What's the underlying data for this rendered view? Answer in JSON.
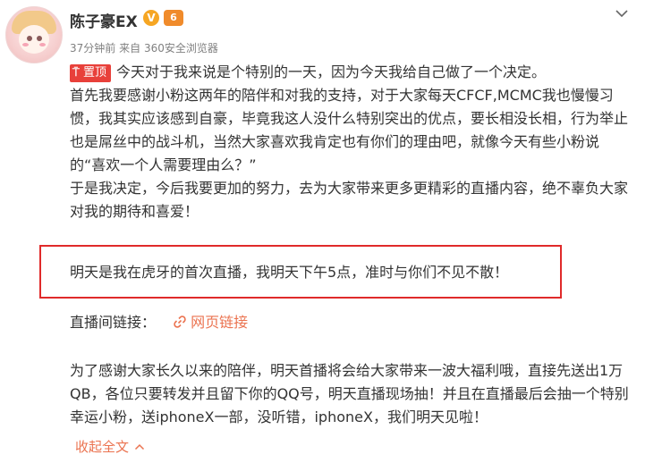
{
  "user": {
    "name": "陈子豪EX",
    "verify_badge": "V",
    "level_badge": "6"
  },
  "meta": {
    "time": "37分钟前",
    "source_prefix": "来自",
    "source": "360安全浏览器"
  },
  "pin_badge": "置顶",
  "post": {
    "intro": "今天对于我来说是个特别的一天，因为今天我给自己做了一个决定。",
    "body1": "首先我要感谢小粉这两年的陪伴和对我的支持，对于大家每天CFCF,MCMC我也慢慢习惯，我其实应该感到自豪，毕竟我这人没什么特别突出的优点，要长相没长相，行为举止也是屌丝中的战斗机，当然大家喜欢我肯定也有你们的理由吧，就像今天有些小粉说的“喜欢一个人需要理由么？”",
    "body2": "于是我决定，今后我要更加的努力，去为大家带来更多更精彩的直播内容，绝不辜负大家对我的期待和喜爱！",
    "highlight": "明天是我在虎牙的首次直播，我明天下午5点，准时与你们不见不散！",
    "link_label": "直播间链接：",
    "link_text": "网页链接",
    "body3": "为了感谢大家长久以来的陪伴，明天首播将会给大家带来一波大福利哦，直接先送出1万QB，各位只要转发并且留下你的QQ号，明天直播现场抽！并且在直播最后会抽一个特别幸运小粉，送iphoneX一部，没听错，iphoneX，我们明天见啦！",
    "collapse_label": "收起全文"
  },
  "icons": {
    "avatar": "avatar",
    "verify": "verified-icon",
    "level": "level-icon",
    "menu": "chevron-down-icon",
    "link": "link-icon",
    "collapse": "chevron-up-icon"
  },
  "colors": {
    "pin": "#e8403a",
    "link": "#eb7350",
    "highlight_border": "#e02a2a"
  }
}
